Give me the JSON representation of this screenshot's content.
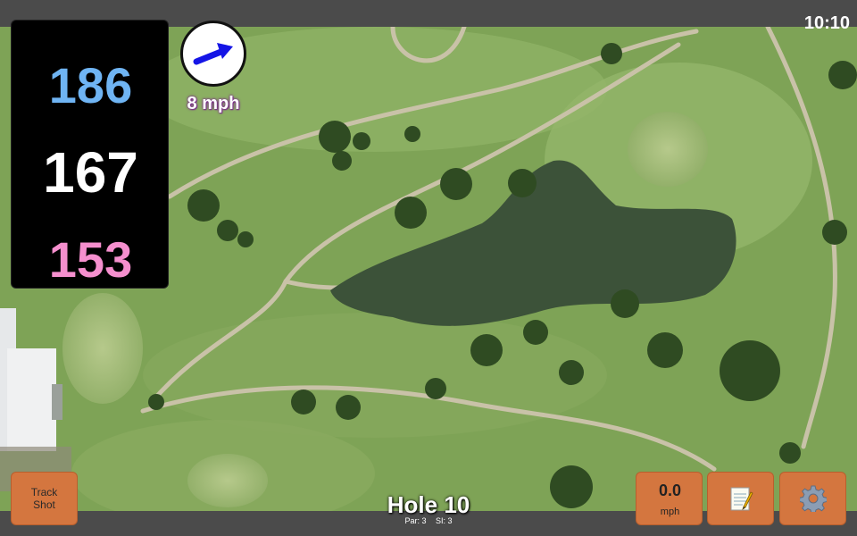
{
  "status": {
    "time": "10:10"
  },
  "distances": {
    "back": "186",
    "center": "167",
    "front": "153"
  },
  "wind": {
    "speed_text": "8 mph",
    "arrow_icon": "wind-direction-arrow-icon",
    "arrow_color": "#1515e6"
  },
  "hole": {
    "title": "Hole 10",
    "par": "Par: 3",
    "si": "SI: 3"
  },
  "buttons": {
    "track_shot_line1": "Track",
    "track_shot_line2": "Shot",
    "wind_value": "0.0",
    "wind_unit": "mph",
    "notes_icon": "notepad-icon",
    "settings_icon": "gear-icon"
  },
  "colors": {
    "back_distance": "#6fb4f3",
    "center_distance": "#ffffff",
    "front_distance": "#f58fce",
    "button_bg": "#d4763f",
    "map_grass": "#7fa457"
  }
}
